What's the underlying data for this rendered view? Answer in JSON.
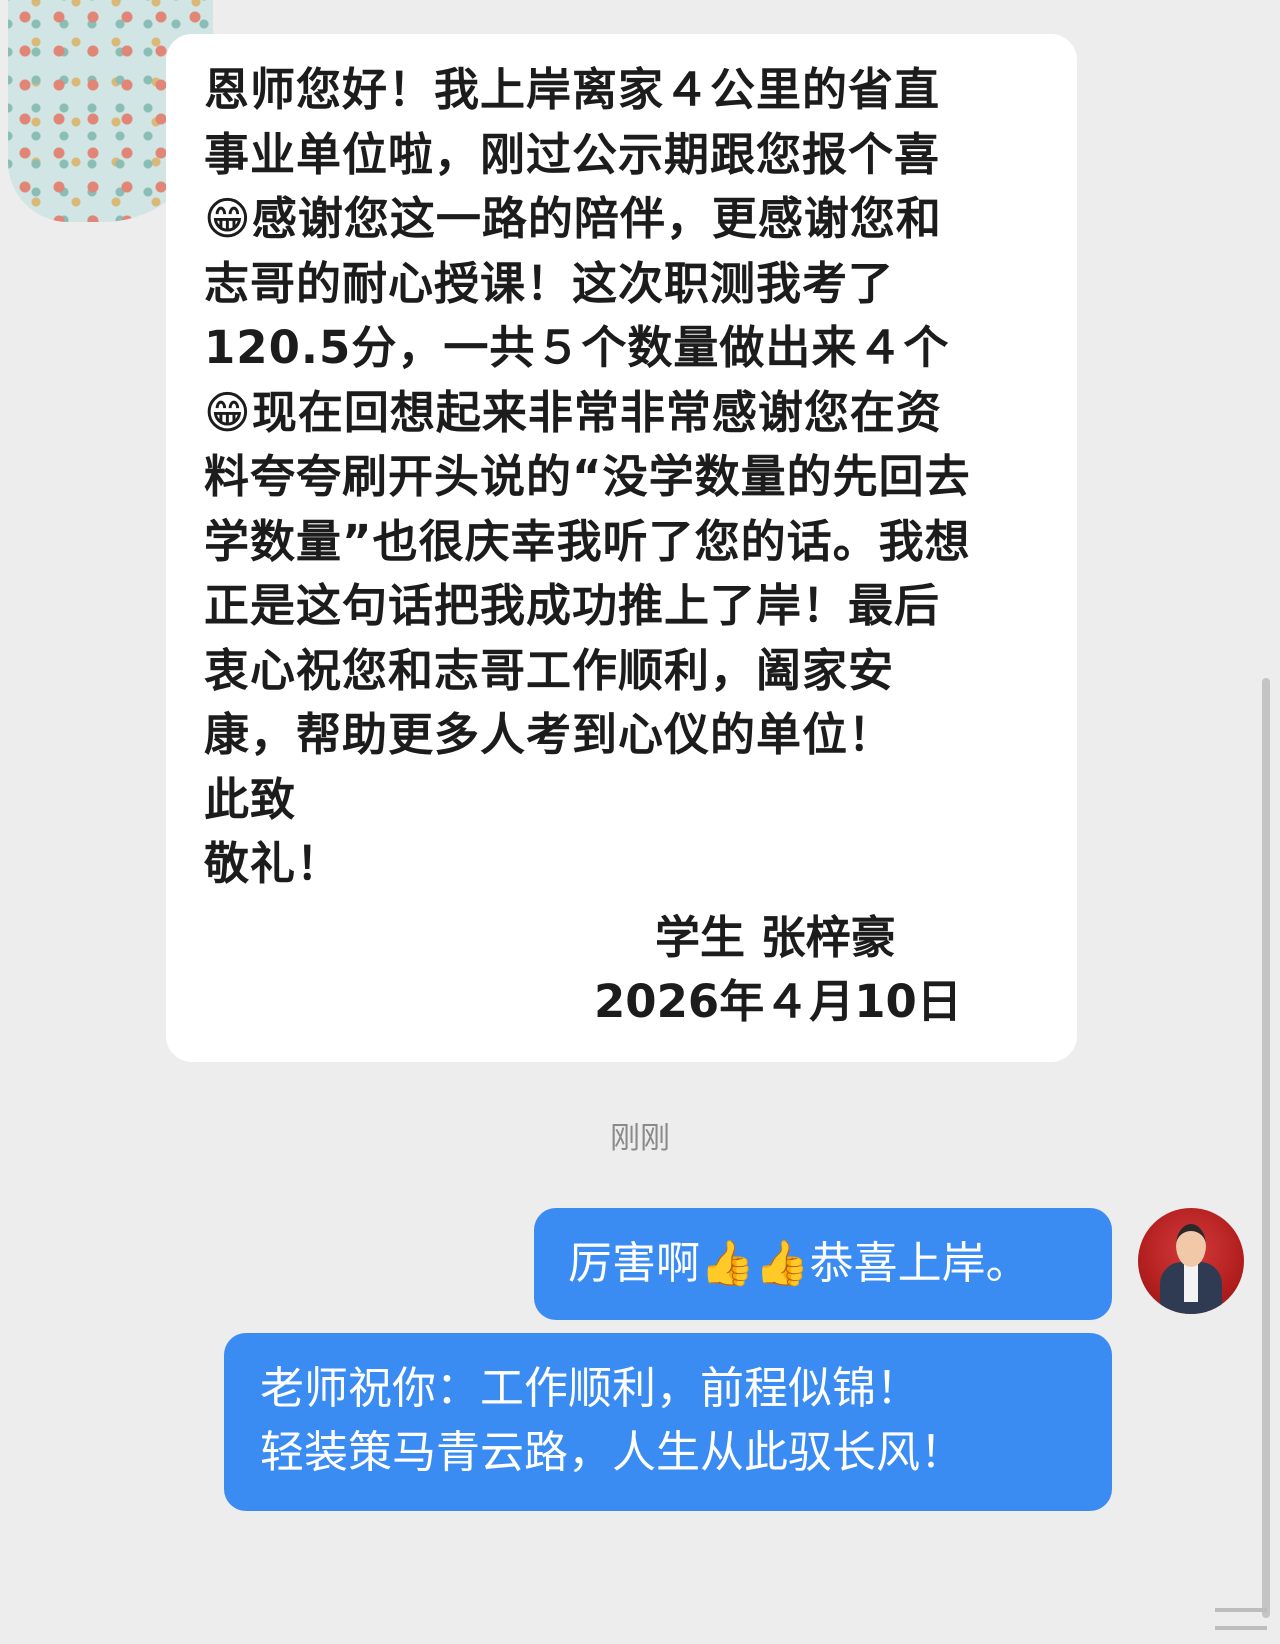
{
  "incoming_message": {
    "lines": [
      "恩师您好！我上岸离家４公里的省直",
      "事业单位啦，刚过公示期跟您报个喜",
      "😁感谢您这一路的陪伴，更感谢您和",
      "志哥的耐心授课！这次职测我考了",
      "120.5分，一共５个数量做出来４个",
      "😁现在回想起来非常非常感谢您在资",
      "料夸夸刷开头说的“没学数量的先回去",
      "学数量”也很庆幸我听了您的话。我想",
      "正是这句话把我成功推上了岸！最后",
      "衷心祝您和志哥工作顺利，阖家安",
      "康，帮助更多人考到心仪的单位！",
      "此致",
      "敬礼！"
    ],
    "signature": "学生 张梓豪",
    "date": "2026年４月10日"
  },
  "timestamp": "刚刚",
  "outgoing_messages": [
    {
      "lines": [
        "厉害啊👍👍恭喜上岸。"
      ]
    },
    {
      "lines": [
        "老师祝你：工作顺利，前程似锦！",
        "轻装策马青云路，人生从此驭长风！"
      ]
    }
  ],
  "colors": {
    "background": "#ededed",
    "incoming_bubble": "#ffffff",
    "outgoing_bubble": "#3a8cf3",
    "teacher_avatar": "#c62a2a"
  }
}
